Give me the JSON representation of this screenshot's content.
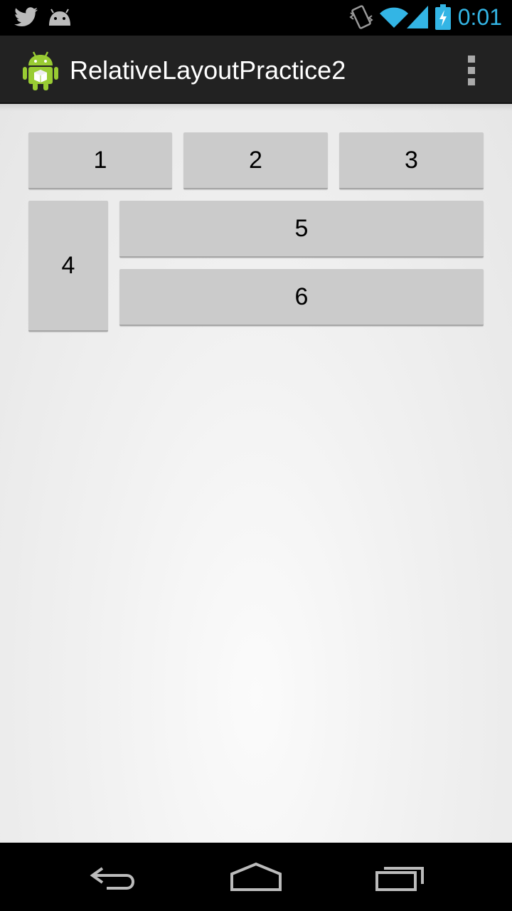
{
  "status_bar": {
    "time": "0:01",
    "icons": [
      "twitter-icon",
      "android-notification-icon",
      "vibrate-icon",
      "wifi-icon",
      "signal-icon",
      "battery-charging-icon"
    ]
  },
  "action_bar": {
    "title": "RelativeLayoutPractice2",
    "app_icon": "android-robot-icon",
    "overflow_icon": "overflow-menu-icon"
  },
  "buttons": {
    "b1": "1",
    "b2": "2",
    "b3": "3",
    "b4": "4",
    "b5": "5",
    "b6": "6"
  },
  "nav_bar": {
    "icons": [
      "back-icon",
      "home-icon",
      "recent-apps-icon"
    ]
  },
  "colors": {
    "accent": "#33b5e5",
    "action_bar": "#222222",
    "button": "#cbcbcb"
  }
}
